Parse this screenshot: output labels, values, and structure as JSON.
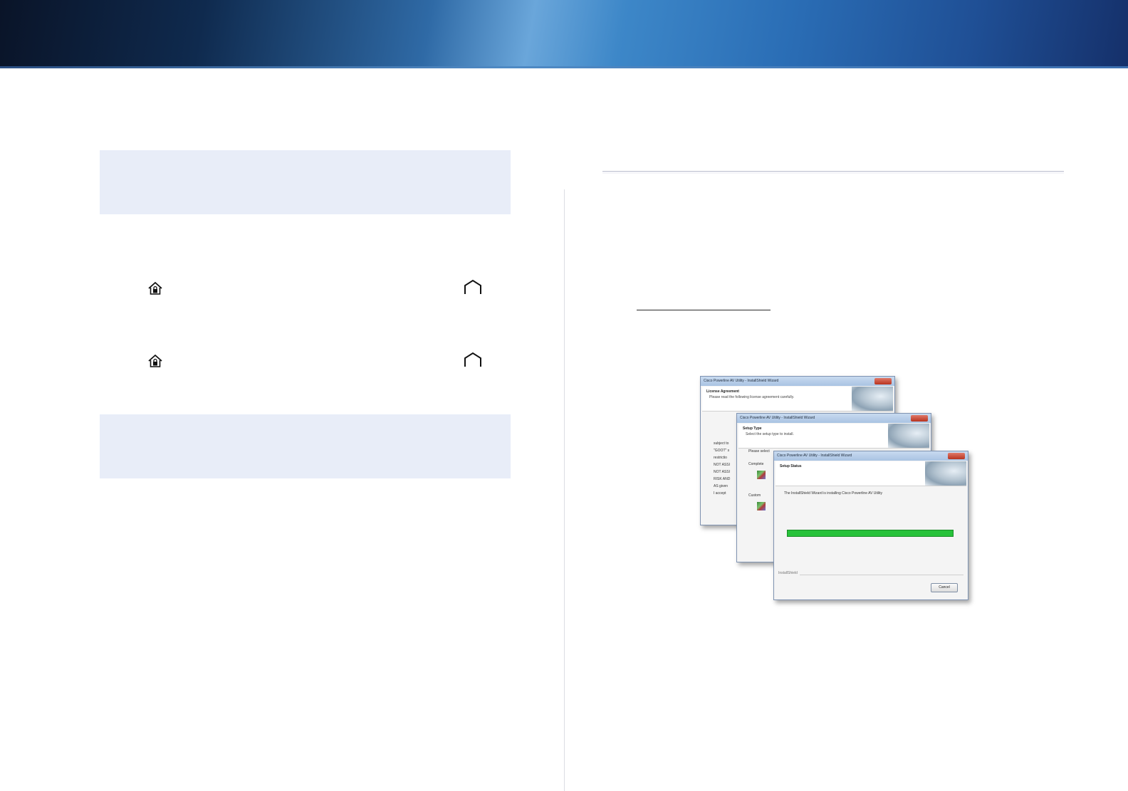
{
  "banner": {
    "accent_dark": "#0a1428",
    "accent_light": "#6aa6da"
  },
  "colors": {
    "note_box": "#e8edf8",
    "progress": "#27c23a",
    "close_button": "#b8331f"
  },
  "icons": {
    "locked_home": "lock-house-icon",
    "open_home": "house-outline-icon"
  },
  "wizard": {
    "title": "Cisco Powerline AV Utility - InstallShield Wizard",
    "dialogs": [
      {
        "header": "License Agreement",
        "subheader": "Please read the following license agreement carefully.",
        "body_lines": [
          "subject to",
          "\"GOOT\" s",
          "restrictio",
          "NOT ASSI",
          "NOT ASSI",
          "RISK AND",
          "AS given",
          "I accept"
        ]
      },
      {
        "header": "Setup Type",
        "subheader": "Select the setup type to install.",
        "body_lines": [
          "Please select",
          "Complete",
          "Custom"
        ]
      },
      {
        "header": "Setup Status",
        "subheader": "",
        "status_text": "The InstallShield Wizard is installing Cisco Powerline AV Utility",
        "progress": 1.0,
        "footer": "InstallShield",
        "cancel_label": "Cancel"
      }
    ]
  }
}
